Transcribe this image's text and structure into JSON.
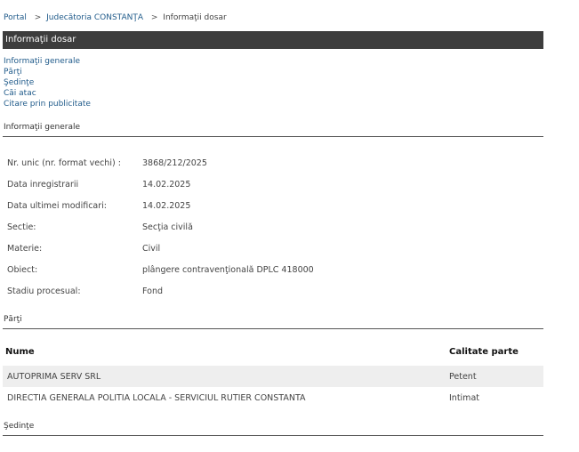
{
  "breadcrumb": {
    "portal": "Portal",
    "court": "Judecătoria CONSTANŢA",
    "current": "Informaţii dosar",
    "separator": ">"
  },
  "titlebar": {
    "title": "Informaţii dosar"
  },
  "nav": {
    "items": [
      {
        "label": "Informaţii generale"
      },
      {
        "label": "Părţi"
      },
      {
        "label": "Şedinţe"
      },
      {
        "label": "Căi atac"
      },
      {
        "label": "Citare prin publicitate"
      }
    ]
  },
  "general": {
    "title": "Informaţii generale",
    "rows": [
      {
        "label": "Nr. unic (nr. format vechi) :",
        "value": "3868/212/2025"
      },
      {
        "label": "Data inregistrarii",
        "value": "14.02.2025"
      },
      {
        "label": "Data ultimei modificari:",
        "value": "14.02.2025"
      },
      {
        "label": "Sectie:",
        "value": "Secţia civilă"
      },
      {
        "label": "Materie:",
        "value": "Civil"
      },
      {
        "label": "Obiect:",
        "value": "plângere contravenţională DPLC 418000"
      },
      {
        "label": "Stadiu procesual:",
        "value": "Fond"
      }
    ]
  },
  "parti": {
    "title": "Părţi",
    "headers": {
      "name": "Nume",
      "role": "Calitate parte"
    },
    "rows": [
      {
        "name": "AUTOPRIMA SERV SRL",
        "role": "Petent"
      },
      {
        "name": "DIRECTIA GENERALA POLITIA LOCALA - SERVICIUL RUTIER CONSTANTA",
        "role": "Intimat"
      }
    ]
  },
  "sedinte": {
    "title": "Şedinţe"
  },
  "colors": {
    "link": "#1f5a8a",
    "titlebar_bg": "#3d3d3d",
    "row_alt": "#eeeeee"
  }
}
